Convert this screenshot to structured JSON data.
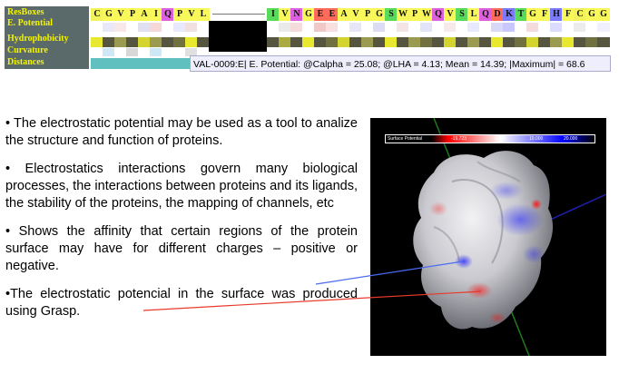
{
  "track": {
    "labels": [
      "ResBoxes",
      "E. Potential",
      "Hydrophobicity",
      "Curvature",
      "Distances"
    ],
    "residues_left": [
      {
        "letter": "C",
        "color": "#f2f25a"
      },
      {
        "letter": "G",
        "color": "#f8f85a"
      },
      {
        "letter": "V",
        "color": "#f8f85a"
      },
      {
        "letter": "P",
        "color": "#f8f85a"
      },
      {
        "letter": "A",
        "color": "#f8f85a"
      },
      {
        "letter": "I",
        "color": "#f8f85a"
      },
      {
        "letter": "Q",
        "color": "#dd60dd"
      },
      {
        "letter": "P",
        "color": "#f8f85a"
      },
      {
        "letter": "V",
        "color": "#f8f85a"
      },
      {
        "letter": "L",
        "color": "#f8f85a"
      }
    ],
    "residues_right": [
      {
        "letter": "I",
        "color": "#5ada5a"
      },
      {
        "letter": "V",
        "color": "#f8f85a"
      },
      {
        "letter": "N",
        "color": "#dd60dd"
      },
      {
        "letter": "G",
        "color": "#f8f85a"
      },
      {
        "letter": "E",
        "color": "#ff6b5a"
      },
      {
        "letter": "E",
        "color": "#ff6b5a"
      },
      {
        "letter": "A",
        "color": "#f8f85a"
      },
      {
        "letter": "V",
        "color": "#f8f85a"
      },
      {
        "letter": "P",
        "color": "#f8f85a"
      },
      {
        "letter": "G",
        "color": "#f8f85a"
      },
      {
        "letter": "S",
        "color": "#5ada5a"
      },
      {
        "letter": "W",
        "color": "#f8f85a"
      },
      {
        "letter": "P",
        "color": "#f8f85a"
      },
      {
        "letter": "W",
        "color": "#f8f85a"
      },
      {
        "letter": "Q",
        "color": "#dd60dd"
      },
      {
        "letter": "V",
        "color": "#f8f85a"
      },
      {
        "letter": "S",
        "color": "#5ada5a"
      },
      {
        "letter": "L",
        "color": "#f8f85a"
      },
      {
        "letter": "Q",
        "color": "#dd60dd"
      },
      {
        "letter": "D",
        "color": "#ff6b5a"
      },
      {
        "letter": "K",
        "color": "#7a7aff"
      },
      {
        "letter": "T",
        "color": "#5ada5a"
      },
      {
        "letter": "G",
        "color": "#f8f85a"
      },
      {
        "letter": "F",
        "color": "#f8f85a"
      },
      {
        "letter": "H",
        "color": "#7a7aff"
      },
      {
        "letter": "F",
        "color": "#f8f85a"
      },
      {
        "letter": "C",
        "color": "#f2f25a"
      },
      {
        "letter": "G",
        "color": "#f8f85a"
      },
      {
        "letter": "G",
        "color": "#f8f85a"
      }
    ],
    "e_potential_left": [
      "#ffffff",
      "#e8e8f8",
      "#f8e8e8",
      "#ffffff",
      "#e0e0f0",
      "#f6d8d8",
      "#ffffff",
      "#e8e8ff",
      "#f0e0e0",
      "#ffffff"
    ],
    "e_potential_right": [
      "#ffffff",
      "#eaeaea",
      "#f4dcdc",
      "#ffffff",
      "#f0c8c8",
      "#f8e0e0",
      "#ffffff",
      "#e6e6f6",
      "#ffffff",
      "#dcdcf4",
      "#ffffff",
      "#f4e4e4",
      "#ffffff",
      "#e4e4f8",
      "#ffffff",
      "#f8eaea",
      "#ffffff",
      "#e8e8ff",
      "#ffffff",
      "#d8d8f8",
      "#c8c8ff",
      "#ffffff",
      "#f4dcdc",
      "#ffffff",
      "#dcdcff",
      "#ffffff",
      "#ececec",
      "#ffffff",
      "#f0f0ff"
    ],
    "hydro_left": [
      "#e8e830",
      "#555540",
      "#9a9a50",
      "#555540",
      "#d4d430",
      "#9a9a50",
      "#555540",
      "#707040",
      "#e8e830",
      "#555540"
    ],
    "hydro_right": [
      "#555540",
      "#aaaa40",
      "#555540",
      "#e8e830",
      "#555540",
      "#707040",
      "#d4d430",
      "#555540",
      "#9a9a50",
      "#555540",
      "#e8e830",
      "#555540",
      "#9a9a50",
      "#707040",
      "#555540",
      "#d4d430",
      "#555540",
      "#9a9a50",
      "#555540",
      "#e8e830",
      "#555540",
      "#707040",
      "#d4d430",
      "#555540",
      "#9a9a50",
      "#e8e830",
      "#555540",
      "#707040",
      "#555540"
    ],
    "curv_left": [
      "#ffffff",
      "#cfe8f8",
      "#ffffff",
      "#d8d8d8",
      "#ffffff",
      "#cfe8f8",
      "#ffffff",
      "#ffffff",
      "#e0e0e0",
      "#ffffff"
    ],
    "dist_left": [
      "#60c0c0",
      "#60c0c0",
      "#60c0c0",
      "#60c0c0",
      "#60c0c0",
      "#60c0c0",
      "#60c0c0",
      "#60c0c0",
      "#60c0c0",
      "#60c0c0"
    ],
    "tooltip": "VAL-0009:E| E. Potential: @Calpha = 25.08; @LHA = 4.13; Mean = 14.39; |Maximum| = 68.6"
  },
  "bullets": [
    "• The electrostatic potential may be used as a tool to analize the structure and function of proteins.",
    "• Electrostatics interactions govern many biological processes, the interactions between proteins and its ligands, the stability of the proteins, the mapping of channels, etc",
    "• Shows the affinity that certain regions of the protein surface may have for different charges – positive or negative.",
    "•The electrostatic potencial in the surface was produced using Grasp."
  ],
  "viewer": {
    "colorbar_label": "Surface Potential",
    "colorbar_ticks": [
      "-19.723",
      "0.000",
      "10.000",
      "20.000"
    ],
    "colors": {
      "negative": "#ff0000",
      "neutral": "#ffffff",
      "positive": "#0000ff"
    }
  },
  "colors": {
    "label_panel": "#5a6a6a",
    "label_text": "#f4f400",
    "tooltip_bg": "#eeeefc",
    "blue_pointer": "#4a6cf0",
    "red_pointer": "#e83a2a"
  }
}
